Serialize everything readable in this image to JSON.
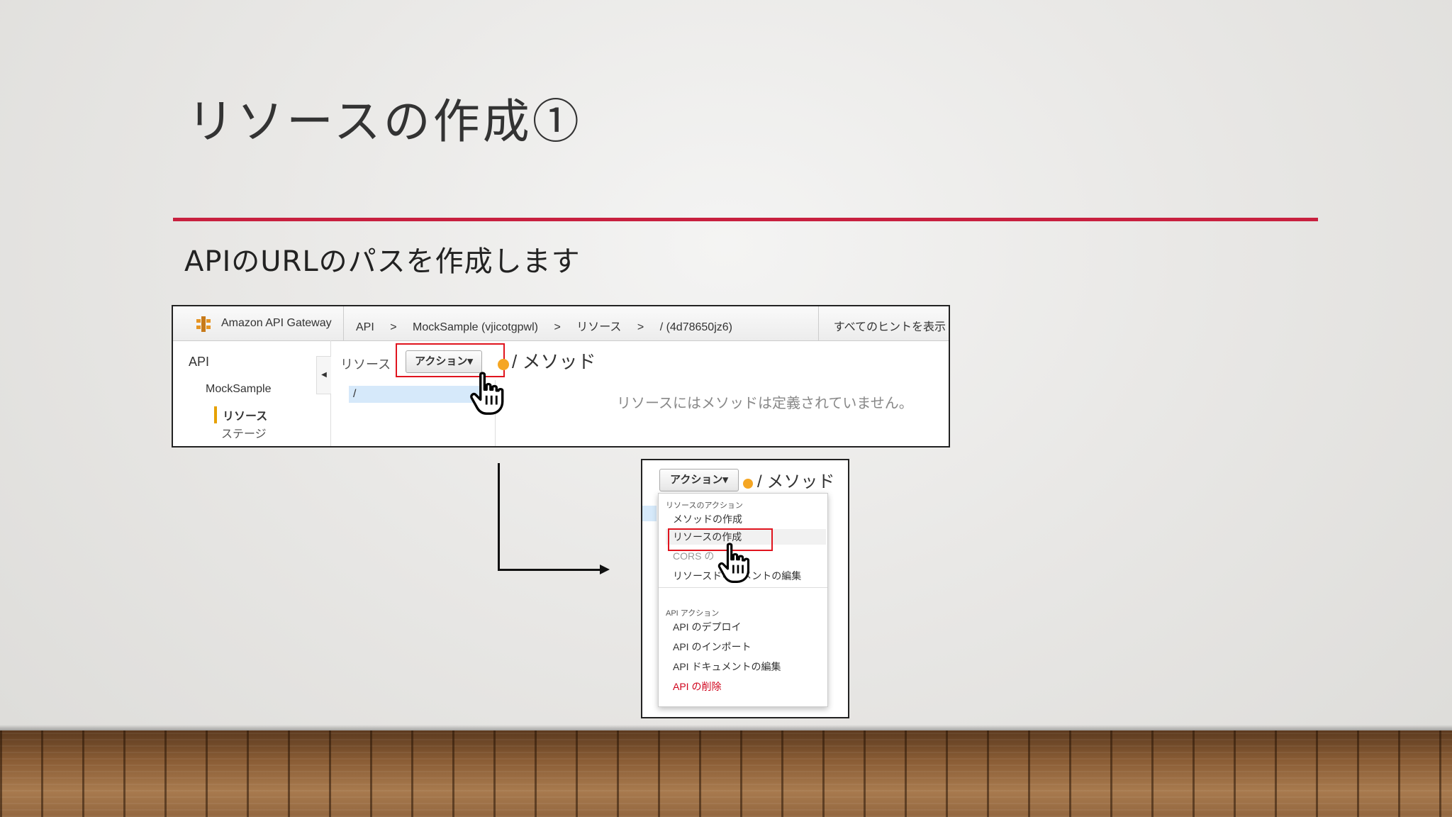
{
  "slide": {
    "title": "リソースの作成①",
    "subtitle": "APIのURLのパスを作成します"
  },
  "shot1": {
    "brand": "Amazon API Gateway",
    "breadcrumbs": [
      "API",
      ">",
      "MockSample (vjicotgpwl)",
      ">",
      "リソース",
      ">",
      "/ (4d78650jz6)"
    ],
    "hints_link": "すべてのヒントを表示",
    "sidebar": {
      "api": "API",
      "api_name": "MockSample",
      "resources": "リソース",
      "stages": "ステージ"
    },
    "resources_label": "リソース",
    "actions_button": "アクション▾",
    "method_title": "/ メソッド",
    "tree_root": "/",
    "empty_message": "リソースにはメソッドは定義されていません。"
  },
  "shot2": {
    "actions_button": "アクション▾",
    "method_title": "/ メソッド",
    "menu": {
      "resource_header": "リソースのアクション",
      "create_method": "メソッドの作成",
      "create_resource": "リソースの作成",
      "cors": "CORS の",
      "edit_resource_doc": "リソースドキュメントの編集",
      "api_header": "API アクション",
      "deploy_api": "API のデプロイ",
      "import_api": "API のインポート",
      "edit_api_doc": "API ドキュメントの編集",
      "delete_api": "API の削除"
    }
  },
  "colors": {
    "accent_rule": "#c8203f",
    "highlight_box": "#e0141e",
    "danger_text": "#d0021b",
    "selection": "#d6e9fa"
  },
  "icons": [
    "api-gateway-logo-icon",
    "hand-pointer-icon",
    "collapse-arrow-icon"
  ]
}
